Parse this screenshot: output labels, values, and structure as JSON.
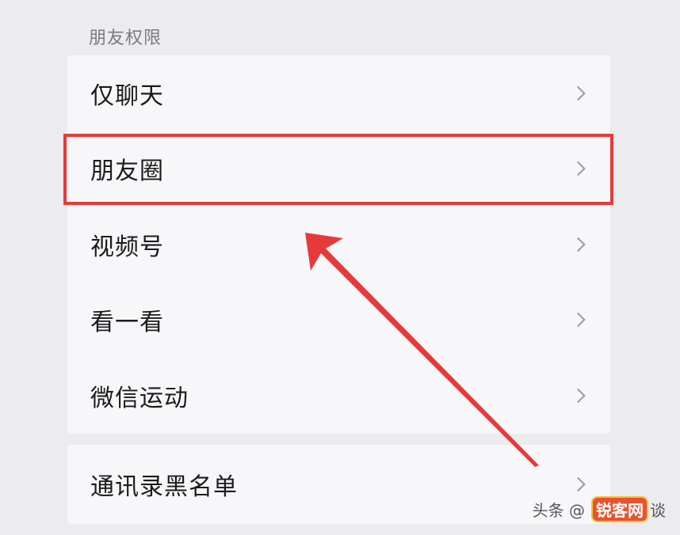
{
  "section_title": "朋友权限",
  "permissions": [
    {
      "label": "仅聊天"
    },
    {
      "label": "朋友圈"
    },
    {
      "label": "视频号"
    },
    {
      "label": "看一看"
    },
    {
      "label": "微信运动"
    }
  ],
  "blacklist": {
    "label": "通讯录黑名单"
  },
  "watermark": {
    "source": "头条 @",
    "badge": "锐客网",
    "tail": "谈"
  },
  "colors": {
    "highlight": "#e63a3a",
    "arrow": "#e63a3a",
    "background": "#ececef",
    "card": "#f7f7f9"
  }
}
